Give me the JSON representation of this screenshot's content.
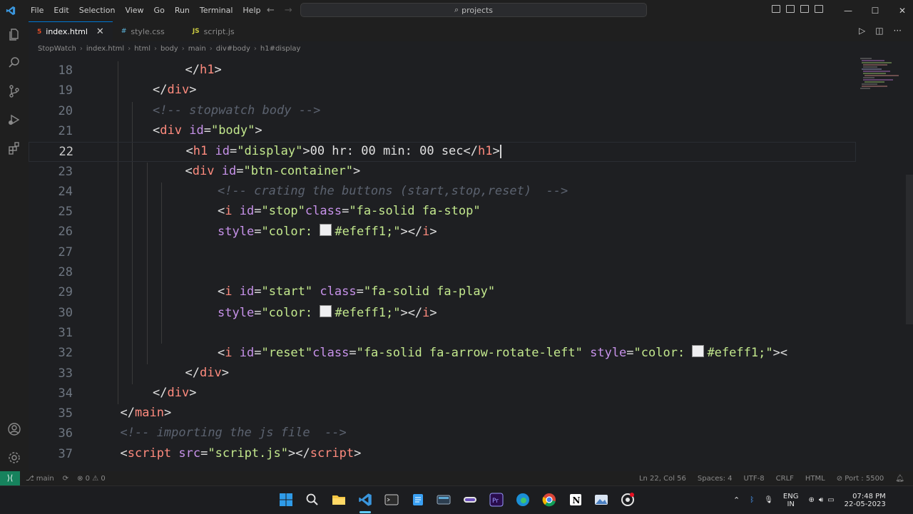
{
  "window": {
    "title": "projects"
  },
  "menu": [
    "File",
    "Edit",
    "Selection",
    "View",
    "Go",
    "Run",
    "Terminal",
    "Help"
  ],
  "tabs": [
    {
      "label": "index.html",
      "icon": "html-file-icon",
      "active": true,
      "color": "#e44d26"
    },
    {
      "label": "style.css",
      "icon": "css-file-icon",
      "active": false,
      "color": "#519aba"
    },
    {
      "label": "script.js",
      "icon": "js-file-icon",
      "active": false,
      "color": "#cbcb41"
    }
  ],
  "breadcrumb": [
    "StopWatch",
    "index.html",
    "html",
    "body",
    "main",
    "div#body",
    "h1#display"
  ],
  "editor": {
    "lines": [
      {
        "n": "18",
        "indent": 5,
        "parts": [
          [
            "br",
            "</"
          ],
          [
            "tag",
            "h1"
          ],
          [
            "br",
            ">"
          ]
        ]
      },
      {
        "n": "19",
        "indent": 4,
        "parts": [
          [
            "br",
            "</"
          ],
          [
            "tag",
            "div"
          ],
          [
            "br",
            ">"
          ]
        ]
      },
      {
        "n": "20",
        "indent": 4,
        "parts": [
          [
            "com",
            "<!-- stopwatch body -->"
          ]
        ]
      },
      {
        "n": "21",
        "indent": 4,
        "parts": [
          [
            "br",
            "<"
          ],
          [
            "tag",
            "div"
          ],
          [
            "txt",
            " "
          ],
          [
            "attr",
            "id"
          ],
          [
            "br",
            "="
          ],
          [
            "str",
            "\"body\""
          ],
          [
            "br",
            ">"
          ]
        ]
      },
      {
        "n": "22",
        "indent": 5,
        "current": true,
        "parts": [
          [
            "br",
            "<"
          ],
          [
            "tag",
            "h1"
          ],
          [
            "txt",
            " "
          ],
          [
            "attr",
            "id"
          ],
          [
            "br",
            "="
          ],
          [
            "str",
            "\"display\""
          ],
          [
            "br",
            ">"
          ],
          [
            "txt",
            "00 hr: 00 min: 00 sec"
          ],
          [
            "br",
            "</"
          ],
          [
            "tag",
            "h1"
          ],
          [
            "br",
            ">"
          ],
          [
            "cursor",
            ""
          ]
        ]
      },
      {
        "n": "23",
        "indent": 5,
        "parts": [
          [
            "br",
            "<"
          ],
          [
            "tag",
            "div"
          ],
          [
            "txt",
            " "
          ],
          [
            "attr",
            "id"
          ],
          [
            "br",
            "="
          ],
          [
            "str",
            "\"btn-container\""
          ],
          [
            "br",
            ">"
          ]
        ]
      },
      {
        "n": "24",
        "indent": 6,
        "parts": [
          [
            "com",
            "<!-- crating the buttons (start,stop,reset)  -->"
          ]
        ]
      },
      {
        "n": "25",
        "indent": 6,
        "parts": [
          [
            "br",
            "<"
          ],
          [
            "tag",
            "i"
          ],
          [
            "txt",
            " "
          ],
          [
            "attr",
            "id"
          ],
          [
            "br",
            "="
          ],
          [
            "str",
            "\"stop\""
          ],
          [
            "attr",
            "class"
          ],
          [
            "br",
            "="
          ],
          [
            "str",
            "\"fa-solid fa-stop\""
          ]
        ]
      },
      {
        "n": "26",
        "indent": 6,
        "parts": [
          [
            "attr",
            "style"
          ],
          [
            "br",
            "="
          ],
          [
            "str",
            "\"color: "
          ],
          [
            "swatch",
            ""
          ],
          [
            "str",
            "#efeff1;\""
          ],
          [
            "br",
            "></"
          ],
          [
            "tag",
            "i"
          ],
          [
            "br",
            ">"
          ]
        ]
      },
      {
        "n": "27",
        "indent": 0,
        "parts": []
      },
      {
        "n": "28",
        "indent": 0,
        "parts": []
      },
      {
        "n": "29",
        "indent": 6,
        "parts": [
          [
            "br",
            "<"
          ],
          [
            "tag",
            "i"
          ],
          [
            "txt",
            " "
          ],
          [
            "attr",
            "id"
          ],
          [
            "br",
            "="
          ],
          [
            "str",
            "\"start\""
          ],
          [
            "txt",
            " "
          ],
          [
            "attr",
            "class"
          ],
          [
            "br",
            "="
          ],
          [
            "str",
            "\"fa-solid fa-play\""
          ]
        ]
      },
      {
        "n": "30",
        "indent": 6,
        "parts": [
          [
            "attr",
            "style"
          ],
          [
            "br",
            "="
          ],
          [
            "str",
            "\"color: "
          ],
          [
            "swatch",
            ""
          ],
          [
            "str",
            "#efeff1;\""
          ],
          [
            "br",
            "></"
          ],
          [
            "tag",
            "i"
          ],
          [
            "br",
            ">"
          ]
        ]
      },
      {
        "n": "31",
        "indent": 0,
        "parts": []
      },
      {
        "n": "32",
        "indent": 6,
        "parts": [
          [
            "br",
            "<"
          ],
          [
            "tag",
            "i"
          ],
          [
            "txt",
            " "
          ],
          [
            "attr",
            "id"
          ],
          [
            "br",
            "="
          ],
          [
            "str",
            "\"reset\""
          ],
          [
            "attr",
            "class"
          ],
          [
            "br",
            "="
          ],
          [
            "str",
            "\"fa-solid fa-arrow-rotate-left\""
          ],
          [
            "txt",
            " "
          ],
          [
            "attr",
            "style"
          ],
          [
            "br",
            "="
          ],
          [
            "str",
            "\"color: "
          ],
          [
            "swatch",
            ""
          ],
          [
            "str",
            "#efeff1;\""
          ],
          [
            "br",
            "><"
          ]
        ]
      },
      {
        "n": "33",
        "indent": 5,
        "parts": [
          [
            "br",
            "</"
          ],
          [
            "tag",
            "div"
          ],
          [
            "br",
            ">"
          ]
        ]
      },
      {
        "n": "34",
        "indent": 4,
        "parts": [
          [
            "br",
            "</"
          ],
          [
            "tag",
            "div"
          ],
          [
            "br",
            ">"
          ]
        ]
      },
      {
        "n": "35",
        "indent": 3,
        "parts": [
          [
            "br",
            "</"
          ],
          [
            "tag",
            "main"
          ],
          [
            "br",
            ">"
          ]
        ]
      },
      {
        "n": "36",
        "indent": 3,
        "parts": [
          [
            "com",
            "<!-- importing the js file  -->"
          ]
        ]
      },
      {
        "n": "37",
        "indent": 3,
        "parts": [
          [
            "br",
            "<"
          ],
          [
            "tag",
            "script"
          ],
          [
            "txt",
            " "
          ],
          [
            "attr",
            "src"
          ],
          [
            "br",
            "="
          ],
          [
            "str",
            "\"script.js\""
          ],
          [
            "br",
            "></"
          ],
          [
            "tag",
            "script"
          ],
          [
            "br",
            ">"
          ]
        ]
      }
    ]
  },
  "statusbar": {
    "branch": "main",
    "problems": "0 ⚠ 0",
    "position": "Ln 22, Col 56",
    "spaces": "Spaces: 4",
    "encoding": "UTF-8",
    "eol": "CRLF",
    "language": "HTML",
    "port": "Port : 5500"
  },
  "tray": {
    "lang1": "ENG",
    "lang2": "IN",
    "time": "07:48 PM",
    "date": "22-05-2023"
  }
}
